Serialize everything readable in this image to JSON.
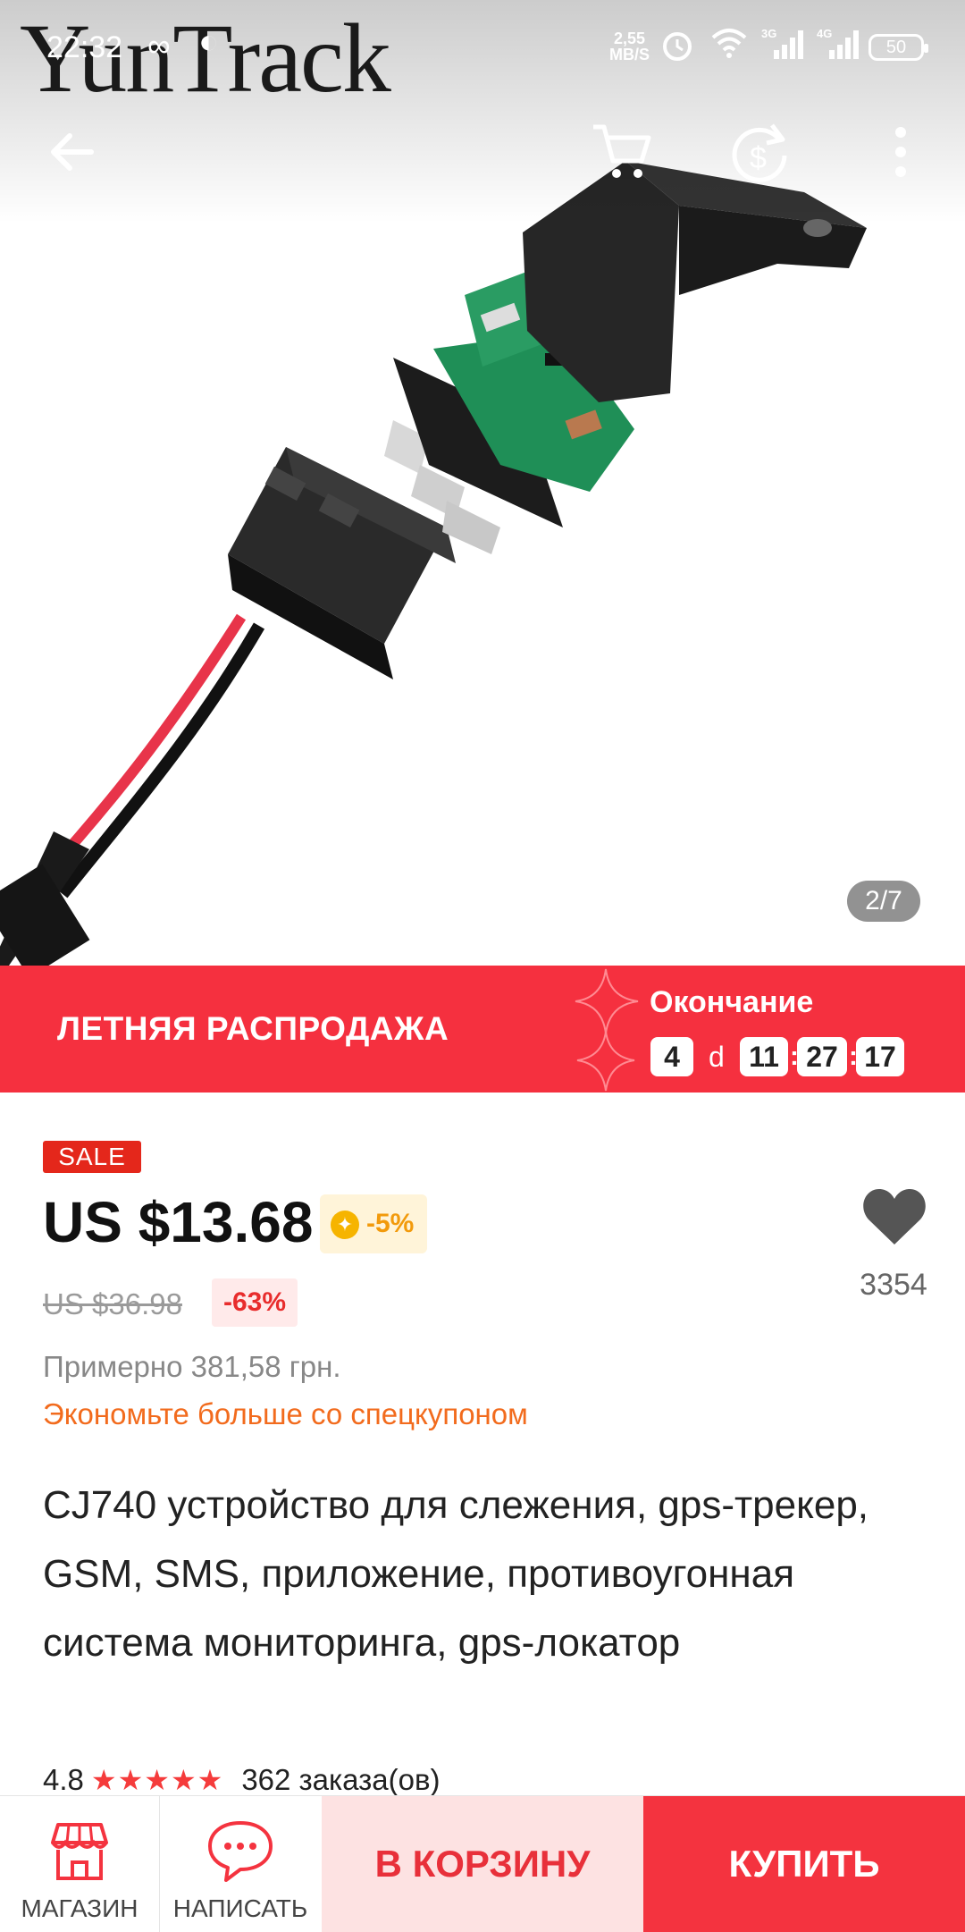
{
  "gallery": {
    "brand_watermark": "YunTrack",
    "counter": "2/7"
  },
  "status_bar": {
    "time": "22:32",
    "net_speed_value": "2,55",
    "net_speed_unit": "MB/S",
    "network_1": "3G",
    "network_2": "4G",
    "battery": "50"
  },
  "nav": {
    "icons": [
      "back-arrow-icon",
      "cart-icon",
      "dollar-share-icon",
      "more-vert-icon"
    ]
  },
  "banner": {
    "title": "ЛЕТНЯЯ РАСПРОДАЖА",
    "ends_label": "Окончание",
    "days": "4",
    "days_unit": "d",
    "hours": "11",
    "minutes": "27",
    "seconds": "17",
    "bg_color": "#f5303f"
  },
  "product": {
    "sale_badge": "SALE",
    "price": "US $13.68",
    "coin_discount": "-5%",
    "old_price": "US $36.98",
    "discount": "-63%",
    "wishlist_count": "3354",
    "approx_price": "Примерно 381,58 грн.",
    "coupon_link": "Экономьте больше со спецкупоном",
    "title": "CJ740 устройство для слежения, gps-трекер, GSM, SMS, приложение, противоугонная система мониторинга, gps-локатор",
    "rating": "4.8",
    "stars": "★★★★★",
    "orders": "362 заказа(ов)"
  },
  "bottom_bar": {
    "store_label": "МАГАЗИН",
    "message_label": "НАПИСАТЬ",
    "cart_button": "В КОРЗИНУ",
    "buy_button": "КУПИТЬ",
    "accent_color": "#f4333f"
  }
}
